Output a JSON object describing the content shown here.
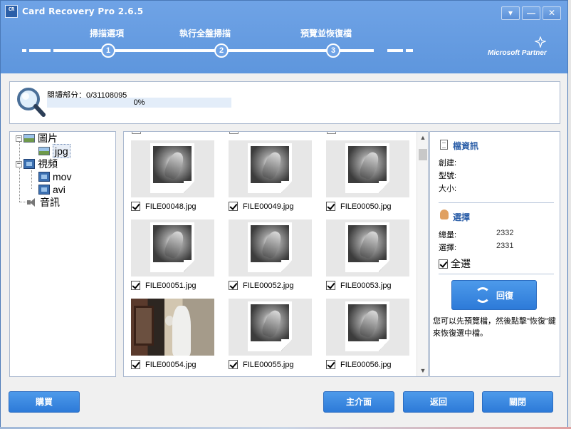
{
  "window": {
    "title": "Card Recovery Pro 2.6.5",
    "icon_text": "CR",
    "minimize_glyph": "▾",
    "restore_glyph": "—",
    "close_glyph": "✕"
  },
  "steps": [
    {
      "number": "1",
      "label": "掃描選項"
    },
    {
      "number": "2",
      "label": "執行全盤掃描"
    },
    {
      "number": "3",
      "label": "預覽並恢復檔"
    }
  ],
  "partner_text": "Microsoft Partner",
  "progress": {
    "label": "閱讀部分：0/31108095",
    "percent_text": "0%",
    "value": 0
  },
  "tree": [
    {
      "label": "圖片",
      "icon": "image-icon",
      "level": 0
    },
    {
      "label": "jpg",
      "icon": "image-icon",
      "level": 1
    },
    {
      "label": "視頻",
      "icon": "film-icon",
      "level": 0
    },
    {
      "label": "mov",
      "icon": "film-icon",
      "level": 1
    },
    {
      "label": "avi",
      "icon": "film-icon",
      "level": 1
    },
    {
      "label": "音訊",
      "icon": "speaker-icon",
      "level": 0
    }
  ],
  "files": [
    {
      "name": "FILE00048.jpg",
      "checked": true,
      "thumb": "placeholder"
    },
    {
      "name": "FILE00049.jpg",
      "checked": true,
      "thumb": "placeholder"
    },
    {
      "name": "FILE00050.jpg",
      "checked": true,
      "thumb": "placeholder"
    },
    {
      "name": "FILE00051.jpg",
      "checked": true,
      "thumb": "placeholder"
    },
    {
      "name": "FILE00052.jpg",
      "checked": true,
      "thumb": "placeholder"
    },
    {
      "name": "FILE00053.jpg",
      "checked": true,
      "thumb": "placeholder"
    },
    {
      "name": "FILE00054.jpg",
      "checked": true,
      "thumb": "photo"
    },
    {
      "name": "FILE00055.jpg",
      "checked": true,
      "thumb": "placeholder"
    },
    {
      "name": "FILE00056.jpg",
      "checked": true,
      "thumb": "placeholder"
    }
  ],
  "info": {
    "file_info_title": "檔資訊",
    "created_label": "創建:",
    "type_label": "型號:",
    "size_label": "大小:",
    "selection_title": "選擇",
    "total_label": "總量:",
    "total_value": "2332",
    "selected_label": "選擇:",
    "selected_value": "2331",
    "select_all_label": "全選",
    "select_all_checked": true,
    "recover_label": "回復",
    "hint": "您可以先預覽檔，然後點擊\"恢復\"鍵來恢復選中檔。"
  },
  "buttons": {
    "buy": "購買",
    "main": "主介面",
    "back": "返回",
    "close": "關閉"
  },
  "colors": {
    "titlebar": "#6fa3e6",
    "button": "#2d7ad8",
    "section_title": "#2b5ea8"
  }
}
